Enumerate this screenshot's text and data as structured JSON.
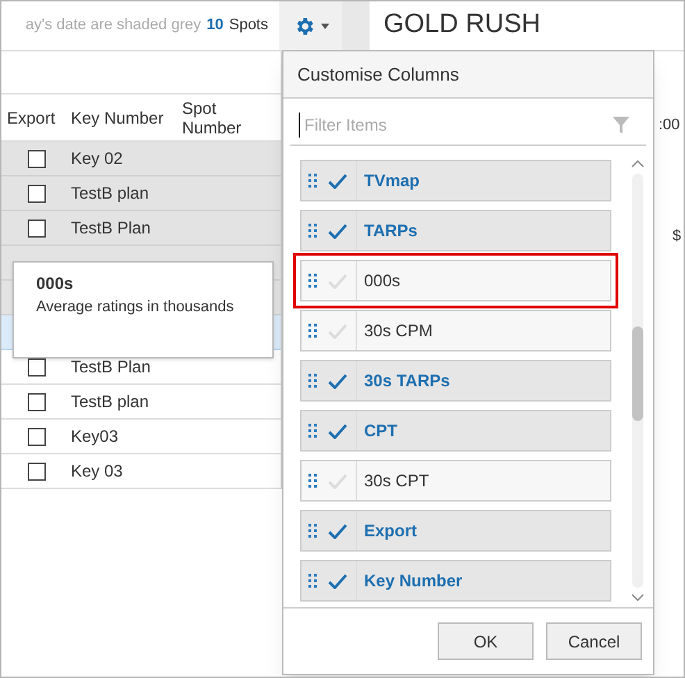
{
  "toolbar": {
    "note": "ay's date are shaded grey",
    "spot_count": "10",
    "spot_label": "Spots",
    "title": "GOLD RUSH"
  },
  "table": {
    "columns": [
      "Export",
      "Key Number",
      "Spot Number"
    ],
    "rows": [
      {
        "key_number": "Key 02",
        "checked": false,
        "shaded": true,
        "selected": false
      },
      {
        "key_number": "TestB plan",
        "checked": false,
        "shaded": true,
        "selected": false
      },
      {
        "key_number": "TestB Plan",
        "checked": false,
        "shaded": true,
        "selected": false
      },
      {
        "key_number": "",
        "shaded": true,
        "selected": false
      },
      {
        "key_number": "",
        "shaded": true,
        "selected": false
      },
      {
        "key_number": "",
        "selected": true
      },
      {
        "key_number": "TestB Plan",
        "checked": false,
        "shaded": false,
        "selected": false
      },
      {
        "key_number": "TestB plan",
        "checked": false,
        "shaded": false,
        "selected": false
      },
      {
        "key_number": "Key03",
        "checked": false,
        "shaded": false,
        "selected": false
      },
      {
        "key_number": "Key 03",
        "checked": false,
        "shaded": false,
        "selected": false
      }
    ],
    "background_fragments": [
      ":00",
      "$"
    ]
  },
  "tooltip": {
    "title": "000s",
    "text": "Average ratings in thousands"
  },
  "popup": {
    "title": "Customise Columns",
    "filter": {
      "placeholder": "Filter Items"
    },
    "items": [
      {
        "label": "TVmap",
        "checked": true,
        "highlighted": false
      },
      {
        "label": "TARPs",
        "checked": true,
        "highlighted": false
      },
      {
        "label": "000s",
        "checked": false,
        "highlighted": true
      },
      {
        "label": "30s CPM",
        "checked": false,
        "highlighted": false
      },
      {
        "label": "30s TARPs",
        "checked": true,
        "highlighted": false
      },
      {
        "label": "CPT",
        "checked": true,
        "highlighted": false
      },
      {
        "label": "30s CPT",
        "checked": false,
        "highlighted": false
      },
      {
        "label": "Export",
        "checked": true,
        "highlighted": false
      },
      {
        "label": "Key Number",
        "checked": true,
        "highlighted": false
      }
    ],
    "buttons": [
      "OK",
      "Cancel"
    ]
  }
}
